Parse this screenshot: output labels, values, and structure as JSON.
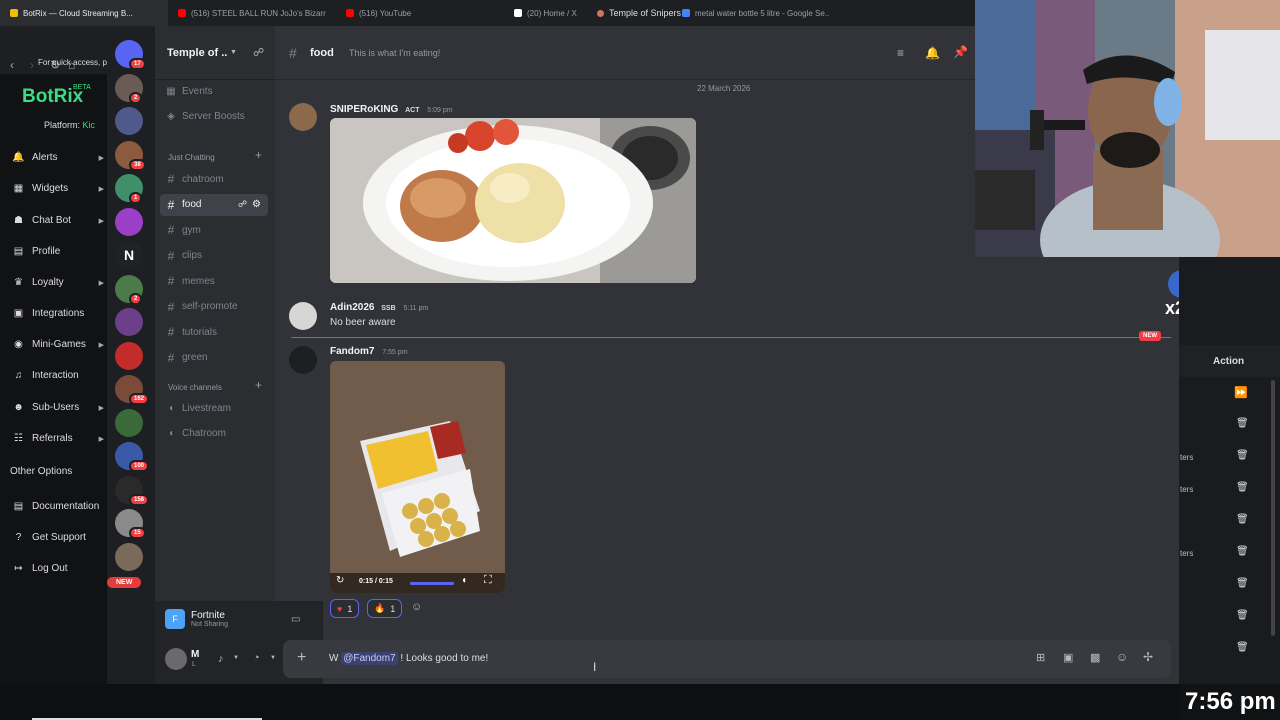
{
  "browser": {
    "tabs": [
      {
        "label": "BotRix — Cloud Streaming B...",
        "color": "#f0c000",
        "active": true
      },
      {
        "label": "(516) STEEL BALL RUN JoJo's Bizarre ...",
        "color": "#ff0000",
        "active": false
      },
      {
        "label": "(516) YouTube",
        "color": "#ff0000",
        "active": false
      },
      {
        "label": "(20) Home / X",
        "color": "#ffffff",
        "active": false
      },
      {
        "label": "metal water bottle 5 litre - Google Se...",
        "color": "#4285f4",
        "active": false
      }
    ],
    "quick_access": "For quick access, p"
  },
  "botrix": {
    "brand": "BotRix",
    "beta": "BETA",
    "platform_label": "Platform: ",
    "platform_value": "Kic",
    "menu": [
      {
        "label": "Alerts",
        "icon": "bell-icon",
        "glyph": "🔔",
        "caret": true
      },
      {
        "label": "Widgets",
        "icon": "grid-icon",
        "glyph": "▦",
        "caret": true
      },
      {
        "label": "Chat Bot",
        "icon": "robot-icon",
        "glyph": "☗",
        "caret": true
      },
      {
        "label": "Profile",
        "icon": "profile-icon",
        "glyph": "▤",
        "caret": false
      },
      {
        "label": "Loyalty",
        "icon": "trophy-icon",
        "glyph": "♛",
        "caret": true
      },
      {
        "label": "Integrations",
        "icon": "integrations-icon",
        "glyph": "▣",
        "caret": false
      },
      {
        "label": "Mini-Games",
        "icon": "gamepad-icon",
        "glyph": "◉",
        "caret": true
      },
      {
        "label": "Interaction",
        "icon": "music-icon",
        "glyph": "♫",
        "caret": false
      },
      {
        "label": "Sub-Users",
        "icon": "users-icon",
        "glyph": "☻",
        "caret": true
      },
      {
        "label": "Referrals",
        "icon": "referrals-icon",
        "glyph": "☷",
        "caret": true
      }
    ],
    "other_options": "Other Options",
    "other_menu": [
      {
        "label": "Documentation",
        "icon": "document-icon",
        "glyph": "▤"
      },
      {
        "label": "Get Support",
        "icon": "help-icon",
        "glyph": "?"
      },
      {
        "label": "Log Out",
        "icon": "logout-icon",
        "glyph": "↦"
      }
    ]
  },
  "discord": {
    "window_title": "Temple of Snipers",
    "server_name": "Temple of ...",
    "server_icons": [
      {
        "color": "#5865f2",
        "badge": "17"
      },
      {
        "color": "#6a5b55",
        "badge": "2"
      },
      {
        "color": "#4f5a8a",
        "badge": ""
      },
      {
        "color": "#8c5a3c",
        "badge": "38"
      },
      {
        "color": "#3f8f6a",
        "badge": "1"
      },
      {
        "color": "#9b3fc9",
        "badge": ""
      },
      {
        "color": "#202225",
        "badge": "",
        "glyph": "N"
      },
      {
        "color": "#4d7a4a",
        "badge": "2"
      },
      {
        "color": "#6b3f8a",
        "badge": ""
      },
      {
        "color": "#c42b2b",
        "badge": ""
      },
      {
        "color": "#7a4a3a",
        "badge": "162"
      },
      {
        "color": "#3a6a3a",
        "badge": ""
      },
      {
        "color": "#3a5aa8",
        "badge": "100"
      },
      {
        "color": "#2a2a2a",
        "badge": "158"
      },
      {
        "color": "#8a8a8a",
        "badge": "15"
      },
      {
        "color": "#7a6a5a",
        "badge": ""
      }
    ],
    "top_channels": [
      {
        "label": "Events",
        "icon": "calendar-icon",
        "glyph": "▦"
      },
      {
        "label": "Server Boosts",
        "icon": "boost-icon",
        "glyph": "◈"
      }
    ],
    "category_text": "Just Chatting",
    "text_channels": [
      "chatroom",
      "food",
      "gym",
      "clips",
      "memes",
      "self-promote",
      "tutorials",
      "green"
    ],
    "active_channel_index": 1,
    "category_voice": "Voice channels",
    "voice_channels": [
      "Livestream",
      "Chatroom"
    ],
    "activity": {
      "game": "Fortnite",
      "status": "Not Sharing"
    },
    "user": {
      "initial": "M",
      "sub": "L"
    }
  },
  "chat": {
    "channel": "food",
    "topic": "This is what I'm eating!",
    "date_separator": "22 March 2026",
    "messages": [
      {
        "user": "SNIPERoKING",
        "tag": "ACT",
        "time": "5:09 pm",
        "text": ""
      },
      {
        "user": "Adin2026",
        "tag": "SSB",
        "time": "5:11 pm",
        "text": "No beer aware"
      },
      {
        "user": "Fandom7",
        "tag": "",
        "time": "7:55 pm",
        "text": ""
      }
    ],
    "new_label": "NEW",
    "video": {
      "time": "0:15 / 0:15",
      "progress": 1.0
    },
    "reactions": [
      {
        "emoji": "♥",
        "count": "1",
        "color": "#f23f43"
      },
      {
        "emoji": "🔥",
        "count": "1",
        "color": "#f5a623"
      }
    ],
    "input": {
      "prefix": "W ",
      "mention": "@Fandom7",
      "suffix": " ! Looks good to me!"
    }
  },
  "right": {
    "action_header": "Action",
    "row_fragments": [
      "",
      "",
      "ters",
      "ters",
      "",
      "ters",
      "",
      "",
      ""
    ],
    "clock": "7:56 pm"
  }
}
